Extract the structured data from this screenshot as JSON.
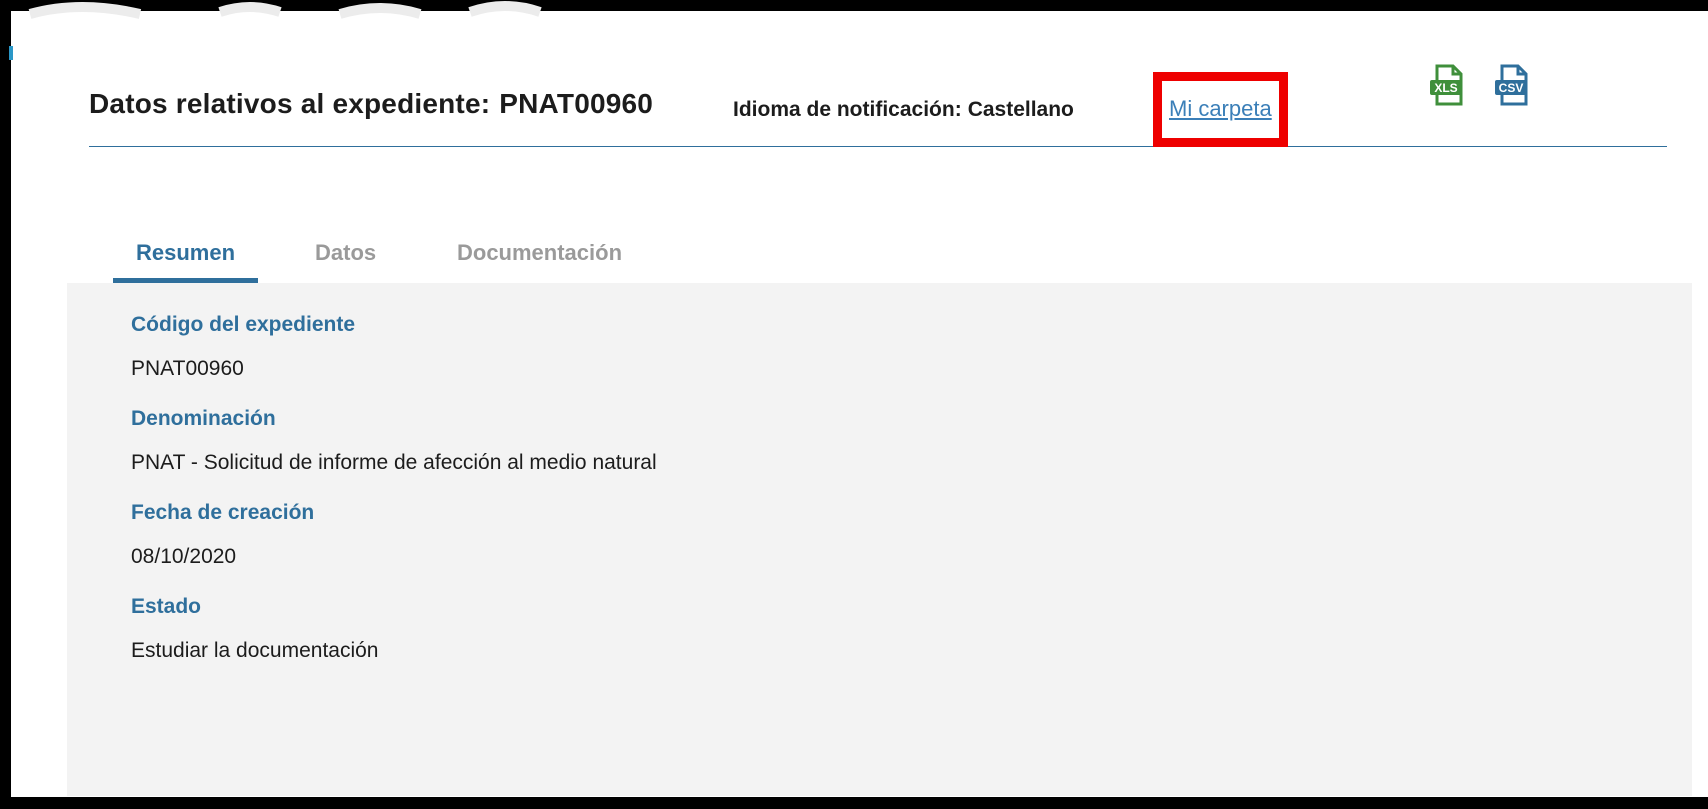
{
  "header": {
    "title_prefix": "Datos relativos al expediente:",
    "expediente_code": "PNAT00960",
    "language_label": "Idioma de notificación:",
    "language_value": "Castellano",
    "folder_link_label": "Mi carpeta",
    "export_buttons": [
      {
        "label": "XLS",
        "icon": "xls-file-icon",
        "color": "#3f8f3b"
      },
      {
        "label": "CSV",
        "icon": "csv-file-icon",
        "color": "#2f6f9c"
      }
    ]
  },
  "tabs": [
    {
      "label": "Resumen",
      "active": true
    },
    {
      "label": "Datos",
      "active": false
    },
    {
      "label": "Documentación",
      "active": false
    }
  ],
  "summary": {
    "fields": [
      {
        "label": "Código del expediente",
        "value": "PNAT00960"
      },
      {
        "label": "Denominación",
        "value": "PNAT - Solicitud de informe de afección al medio natural"
      },
      {
        "label": "Fecha de creación",
        "value": "08/10/2020"
      },
      {
        "label": "Estado",
        "value": "Estudiar la documentación"
      }
    ]
  },
  "colors": {
    "accent": "#2f6f9c",
    "link": "#3b7fb8",
    "highlight": "#ee0000",
    "panel_bg": "#f3f3f3"
  }
}
